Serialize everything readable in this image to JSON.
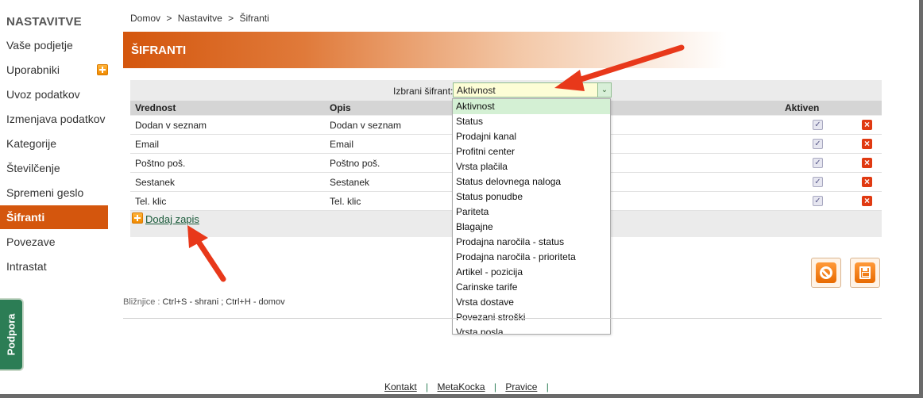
{
  "sidebar": {
    "title": "NASTAVITVE",
    "items": [
      {
        "label": "Vaše podjetje"
      },
      {
        "label": "Uporabniki"
      },
      {
        "label": "Uvoz podatkov"
      },
      {
        "label": "Izmenjava podatkov"
      },
      {
        "label": "Kategorije"
      },
      {
        "label": "Številčenje"
      },
      {
        "label": "Spremeni geslo"
      },
      {
        "label": "Šifranti"
      },
      {
        "label": "Povezave"
      },
      {
        "label": "Intrastat"
      }
    ],
    "active": "Šifranti",
    "support_tab": "Podpora"
  },
  "breadcrumb": {
    "items": [
      "Domov",
      "Nastavitve",
      "Šifranti"
    ],
    "separator": ">"
  },
  "page": {
    "title": "ŠIFRANTI"
  },
  "selector": {
    "label": "Izbrani šifrant:",
    "value": "Aktivnost",
    "options": [
      "Aktivnost",
      "Status",
      "Prodajni kanal",
      "Profitni center",
      "Vrsta plačila",
      "Status delovnega naloga",
      "Status ponudbe",
      "Pariteta",
      "Blagajne",
      "Prodajna naročila - status",
      "Prodajna naročila - prioriteta",
      "Artikel - pozicija",
      "Carinske tarife",
      "Vrsta dostave",
      "Povezani stroški",
      "Vrsta posla"
    ]
  },
  "table": {
    "headers": {
      "value": "Vrednost",
      "description": "Opis",
      "active": "Aktiven"
    },
    "rows": [
      {
        "value": "Dodan v seznam",
        "description": "Dodan v seznam",
        "active": true
      },
      {
        "value": "Email",
        "description": "Email",
        "active": true
      },
      {
        "value": "Poštno poš.",
        "description": "Poštno poš.",
        "active": true
      },
      {
        "value": "Sestanek",
        "description": "Sestanek",
        "active": true
      },
      {
        "value": "Tel. klic",
        "description": "Tel. klic",
        "active": true
      }
    ],
    "add_link": "Dodaj zapis"
  },
  "shortcuts": {
    "label": "Bližnjice :",
    "text": "Ctrl+S - shrani ;  Ctrl+H - domov"
  },
  "footer": {
    "links": [
      "Kontakt",
      "MetaKocka",
      "Pravice"
    ],
    "separator": "|"
  },
  "colors": {
    "accent": "#d4560d",
    "support": "#2c7d55",
    "arrow": "#e8381a"
  }
}
